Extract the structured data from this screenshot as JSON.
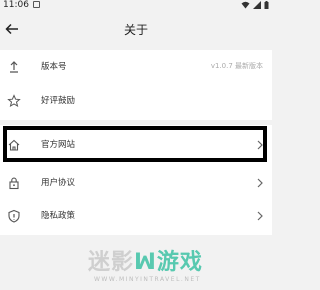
{
  "status": {
    "time": "11:06"
  },
  "header": {
    "title": "关于"
  },
  "rows_top": [
    {
      "label": "版本号",
      "value": "v1.0.7 最新版本",
      "icon": "upload-icon"
    },
    {
      "label": "好评鼓励",
      "value": "",
      "icon": "star-icon"
    }
  ],
  "rows_bottom": [
    {
      "label": "官方网站",
      "icon": "home-icon"
    },
    {
      "label": "用户协议",
      "icon": "lock-icon"
    },
    {
      "label": "隐私政策",
      "icon": "shield-icon"
    }
  ],
  "watermark": {
    "main_left": "迷影",
    "main_right": "游戏",
    "sub": "WWW.MINYINTRAVEL.NET"
  }
}
